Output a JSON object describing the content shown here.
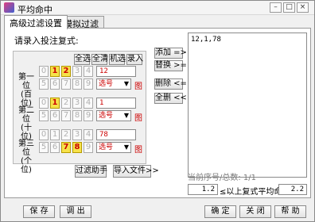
{
  "window": {
    "title": "平均命中",
    "min": "–",
    "max": "□",
    "close": "×"
  },
  "tabs": [
    {
      "label": "高级过滤设置"
    },
    {
      "label": "模拟过滤"
    }
  ],
  "left": {
    "prompt": "请录入投注复式:",
    "quick_buttons": [
      "全选",
      "全清",
      "机选",
      "录入"
    ],
    "positions": [
      {
        "label_line1": "第一位",
        "label_line2": "(百位)",
        "row1": [
          "0",
          "1",
          "2",
          "3",
          "4"
        ],
        "row2": [
          "5",
          "6",
          "7",
          "8",
          "9"
        ],
        "input": "12",
        "select": "选号",
        "tu": "图"
      },
      {
        "label_line1": "第二位",
        "label_line2": "(十位)",
        "row1": [
          "0",
          "1",
          "2",
          "3",
          "4"
        ],
        "row2": [
          "5",
          "6",
          "7",
          "8",
          "9"
        ],
        "input": "1",
        "select": "选号",
        "tu": "图"
      },
      {
        "label_line1": "第三位",
        "label_line2": "(个位)",
        "row1": [
          "0",
          "1",
          "2",
          "3",
          "4"
        ],
        "row2": [
          "5",
          "6",
          "7",
          "8",
          "9"
        ],
        "input": "78",
        "select": "选号",
        "tu": "图"
      }
    ],
    "filter_button": "过滤助手",
    "import_button": "导入文件>>"
  },
  "middle": {
    "add": "添加 =>",
    "replace": "替换 >=",
    "delete": "删除 <=",
    "delete_all": "全删 <<"
  },
  "right": {
    "content": "12,1,78",
    "status": "当前序号/总数: 1/1",
    "value_left": "1.2",
    "condition": "≤以上复式平均命中≤",
    "value_right": "2.2"
  },
  "bottom": {
    "save": "保 存",
    "load": "调 出",
    "ok": "确 定",
    "close": "关 闭",
    "help": "帮 助"
  }
}
